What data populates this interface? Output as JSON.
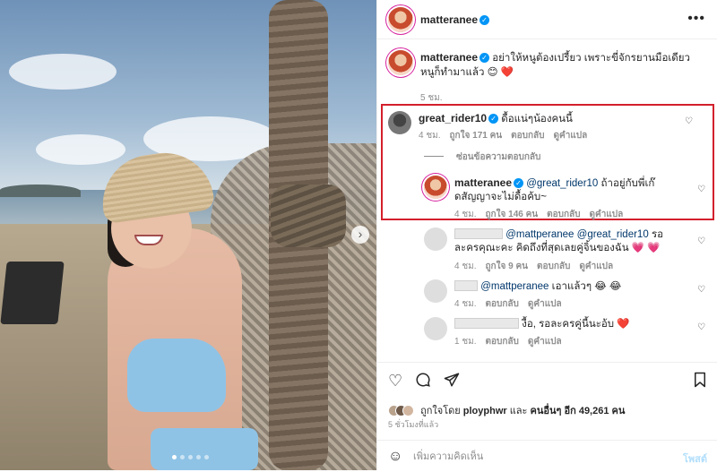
{
  "photo": {
    "next_icon": "chevron-right-icon",
    "carousel_dots": 5,
    "active_dot": 1
  },
  "header": {
    "username": "matteranee",
    "verified_icon": "verified-badge-icon",
    "more_label": "•••"
  },
  "caption": {
    "username": "matteranee",
    "text": "อย่าให้หนูต้องเปรี้ยว เพราะขี่จักรยานมือเดียวหนูก็ทำมาแล้ว 😊 ❤️",
    "time": "5 ชม."
  },
  "comments": [
    {
      "username": "great_rider10",
      "text": "ดื้อแน่ๆน้องคนนี้",
      "time": "4 ชม.",
      "likes": "ถูกใจ 171 คน",
      "reply": "ตอบกลับ",
      "translate": "ดูคำแปล"
    },
    {
      "username": "matteranee",
      "mention": "@great_rider10",
      "text": "ถ้าอยู่กับพี่เก๊ดสัญญาจะไม่ดื้อค้บ~",
      "time": "4 ชม.",
      "likes": "ถูกใจ 146 คน",
      "reply": "ตอบกลับ",
      "translate": "ดูคำแปล"
    },
    {
      "mention": "@mattperanee @great_rider10",
      "text": "รอละครคุณะคะ คิดถึงที่สุดเลยคู่จิ้นของฉัน 💗 💗",
      "time": "4 ชม.",
      "likes": "ถูกใจ 9 คน",
      "reply": "ตอบกลับ",
      "translate": "ดูคำแปล"
    },
    {
      "mention": "@mattperanee",
      "text": "เอาแล้วๆ 😂 😂",
      "time": "4 ชม.",
      "reply": "ตอบกลับ",
      "translate": "ดูคำแปล"
    },
    {
      "text": "งื้อ, รอละครคู่นี้นะอ้บ ❤️",
      "time": "1 ชม.",
      "reply": "ตอบกลับ",
      "translate": "ดูคำแปล"
    }
  ],
  "hide_replies": "ซ่อนข้อความตอบกลับ",
  "actions": {
    "like_icon": "heart-outline-icon",
    "comment_icon": "comment-bubble-icon",
    "share_icon": "paper-plane-icon",
    "save_icon": "bookmark-icon"
  },
  "liked_by": {
    "prefix": "ถูกใจโดย",
    "user": "ployphwr",
    "middle": "และ",
    "others": "คนอื่นๆ อีก 49,261 คน"
  },
  "time_ago": "5 ชั่วโมงที่แล้ว",
  "add_comment": {
    "emoji_icon": "smiley-icon",
    "placeholder": "เพิ่มความคิดเห็น",
    "post_label": "โพสต์"
  }
}
